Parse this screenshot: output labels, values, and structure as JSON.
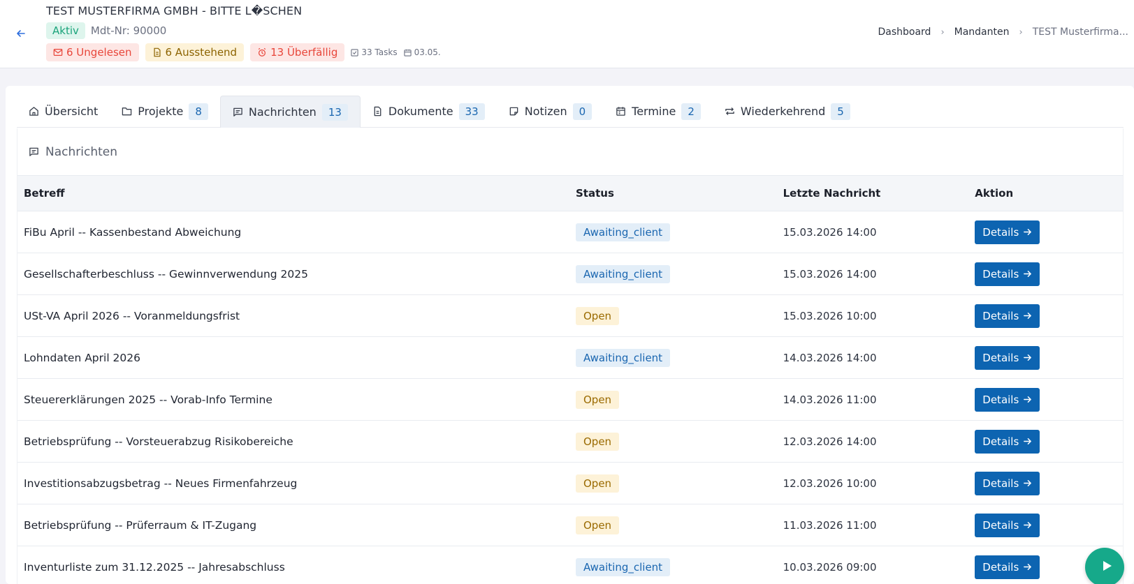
{
  "header": {
    "title": "TEST MUSTERFIRMA GMBH - BITTE L�SCHEN",
    "status_badge": "Aktiv",
    "mandant_nr": "Mdt-Nr: 90000",
    "pills": {
      "unread": "6 Ungelesen",
      "pending": "6 Ausstehend",
      "overdue": "13 Überfällig"
    },
    "tasks": "33 Tasks",
    "date": "03.05."
  },
  "breadcrumb": [
    "Dashboard",
    "Mandanten",
    "TEST Musterfirma..."
  ],
  "tabs": [
    {
      "label": "Übersicht",
      "count": null
    },
    {
      "label": "Projekte",
      "count": "8"
    },
    {
      "label": "Nachrichten",
      "count": "13"
    },
    {
      "label": "Dokumente",
      "count": "33"
    },
    {
      "label": "Notizen",
      "count": "0"
    },
    {
      "label": "Termine",
      "count": "2"
    },
    {
      "label": "Wiederkehrend",
      "count": "5"
    }
  ],
  "section": {
    "title": "Nachrichten",
    "columns": [
      "Betreff",
      "Status",
      "Letzte Nachricht",
      "Aktion"
    ],
    "action_label": "Details",
    "rows": [
      {
        "subject": "FiBu April -- Kassenbestand Abweichung",
        "status": "Awaiting_client",
        "last": "15.03.2026 14:00"
      },
      {
        "subject": "Gesellschafterbeschluss -- Gewinnverwendung 2025",
        "status": "Awaiting_client",
        "last": "15.03.2026 14:00"
      },
      {
        "subject": "USt-VA April 2026 -- Voranmeldungsfrist",
        "status": "Open",
        "last": "15.03.2026 10:00"
      },
      {
        "subject": "Lohndaten April 2026",
        "status": "Awaiting_client",
        "last": "14.03.2026 14:00"
      },
      {
        "subject": "Steuererklärungen 2025 -- Vorab-Info Termine",
        "status": "Open",
        "last": "14.03.2026 11:00"
      },
      {
        "subject": "Betriebsprüfung -- Vorsteuerabzug Risikobereiche",
        "status": "Open",
        "last": "12.03.2026 14:00"
      },
      {
        "subject": "Investitionsabzugsbetrag -- Neues Firmenfahrzeug",
        "status": "Open",
        "last": "12.03.2026 10:00"
      },
      {
        "subject": "Betriebsprüfung -- Prüferraum & IT-Zugang",
        "status": "Open",
        "last": "11.03.2026 11:00"
      },
      {
        "subject": "Inventurliste zum 31.12.2025 -- Jahresabschluss",
        "status": "Awaiting_client",
        "last": "10.03.2026 09:00"
      }
    ]
  }
}
